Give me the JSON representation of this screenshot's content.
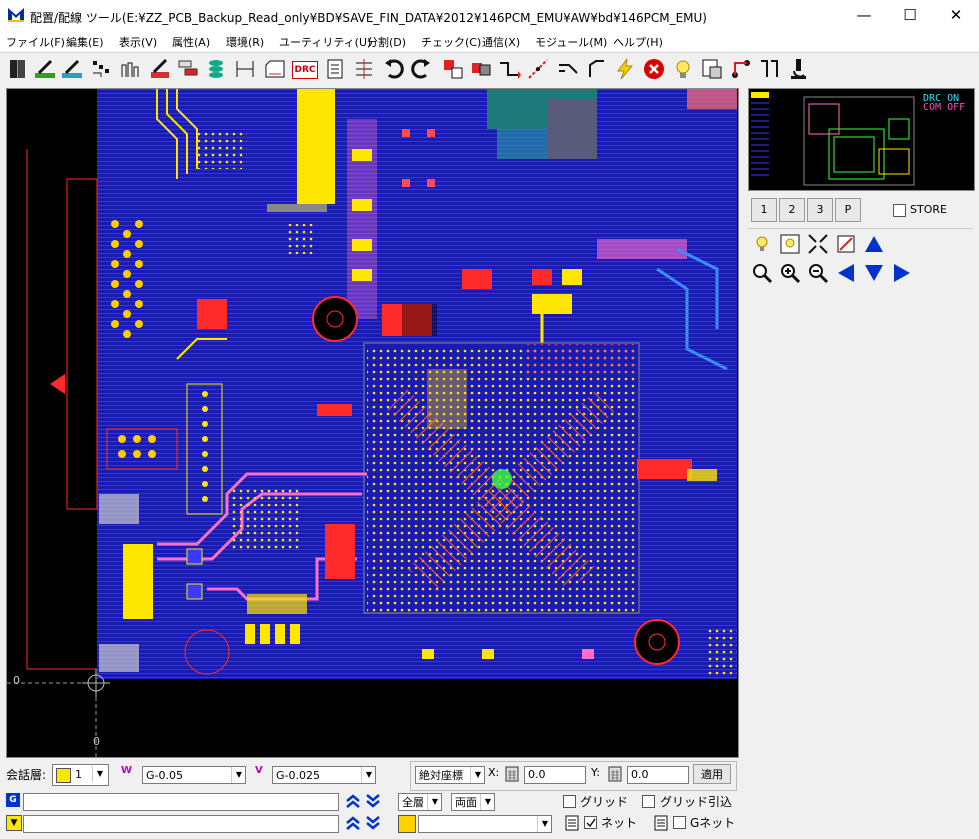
{
  "window": {
    "title": "配置/配線 ツール(E:¥ZZ_PCB_Backup_Read_only¥BD¥SAVE_FIN_DATA¥2012¥146PCM_EMU¥AW¥bd¥146PCM_EMU)",
    "minimize": "—",
    "maximize": "☐",
    "close": "✕"
  },
  "menu": [
    "ファイル(F)",
    "編集(E)",
    "表示(V)",
    "属性(A)",
    "環境(R)",
    "ユーティリティ(U)",
    "分割(D)",
    "チェック(C)",
    "通信(X)",
    "モジュール(M)",
    "ヘルプ(H)"
  ],
  "toolbar": {
    "drc_label": "DRC",
    "icons": [
      "book-icon",
      "pen-icon",
      "eraser-icon",
      "component-icon",
      "pins-icon",
      "edit-icon",
      "layers-icon",
      "via-icon",
      "measure-icon",
      "outline-icon",
      "drc-icon",
      "document-icon",
      "spacing-icon",
      "undo-icon",
      "redo-icon",
      "move-icon",
      "copy-icon",
      "route-icon",
      "diagonal-icon",
      "trace-icon",
      "corner-icon",
      "lightning-icon",
      "stop-icon",
      "highlight-icon",
      "property-icon",
      "net-icon",
      "probe-icon",
      "microscope-icon"
    ]
  },
  "minimap": {
    "drc_status": "DRC ON",
    "com_status": "COM OFF"
  },
  "view_buttons": [
    "1",
    "2",
    "3",
    "P"
  ],
  "store_label": "STORE",
  "canvas": {
    "coord_x0": "0",
    "coord_y0": "0"
  },
  "bottom": {
    "layer_label": "会話層:",
    "layer_value": "1",
    "wire_value": "G-0.05",
    "via_value": "G-0.025",
    "coord_mode": "絶対座標",
    "x_label": "X:",
    "x_value": "0.0",
    "y_label": "Y:",
    "y_value": "0.0",
    "apply_label": "適用",
    "layer_scope": "全層",
    "side_scope": "両面",
    "grid_label": "グリッド",
    "grid_snap_label": "グリッド引込",
    "net_label": "ネット",
    "gnet_label": "Gネット",
    "net_checked": true,
    "gnet_checked": false
  },
  "colors": {
    "board": "#1a1ab4",
    "trace_yellow": "#ffe600",
    "trace_pink": "#ff6fc8",
    "trace_red": "#ff2a2a",
    "accent_blue": "#0033cc"
  }
}
